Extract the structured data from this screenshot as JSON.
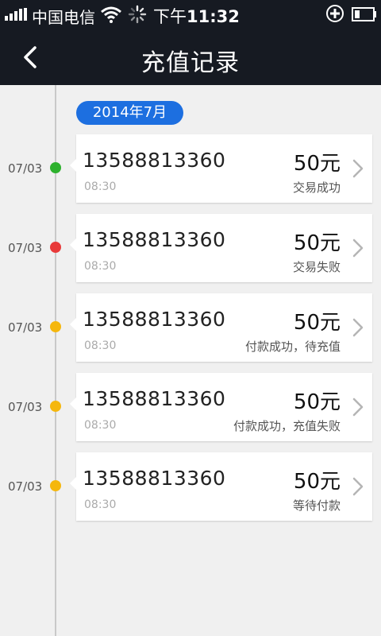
{
  "status_bar": {
    "carrier": "中国电信",
    "time_prefix": "下午",
    "time": "11:32"
  },
  "header": {
    "title": "充值记录"
  },
  "month": "2014年7月",
  "records": [
    {
      "date": "07/03",
      "phone": "13588813360",
      "time": "08:30",
      "amount": "50元",
      "status": "交易成功",
      "dot_color": "#2db12d"
    },
    {
      "date": "07/03",
      "phone": "13588813360",
      "time": "08:30",
      "amount": "50元",
      "status": "交易失败",
      "dot_color": "#e83a3a"
    },
    {
      "date": "07/03",
      "phone": "13588813360",
      "time": "08:30",
      "amount": "50元",
      "status": "付款成功，待充值",
      "dot_color": "#f5b70d"
    },
    {
      "date": "07/03",
      "phone": "13588813360",
      "time": "08:30",
      "amount": "50元",
      "status": "付款成功，充值失败",
      "dot_color": "#f5b70d"
    },
    {
      "date": "07/03",
      "phone": "13588813360",
      "time": "08:30",
      "amount": "50元",
      "status": "等待付款",
      "dot_color": "#f5b70d"
    }
  ],
  "colors": {
    "header_bg": "#161a22",
    "accent": "#1d6fe0"
  }
}
